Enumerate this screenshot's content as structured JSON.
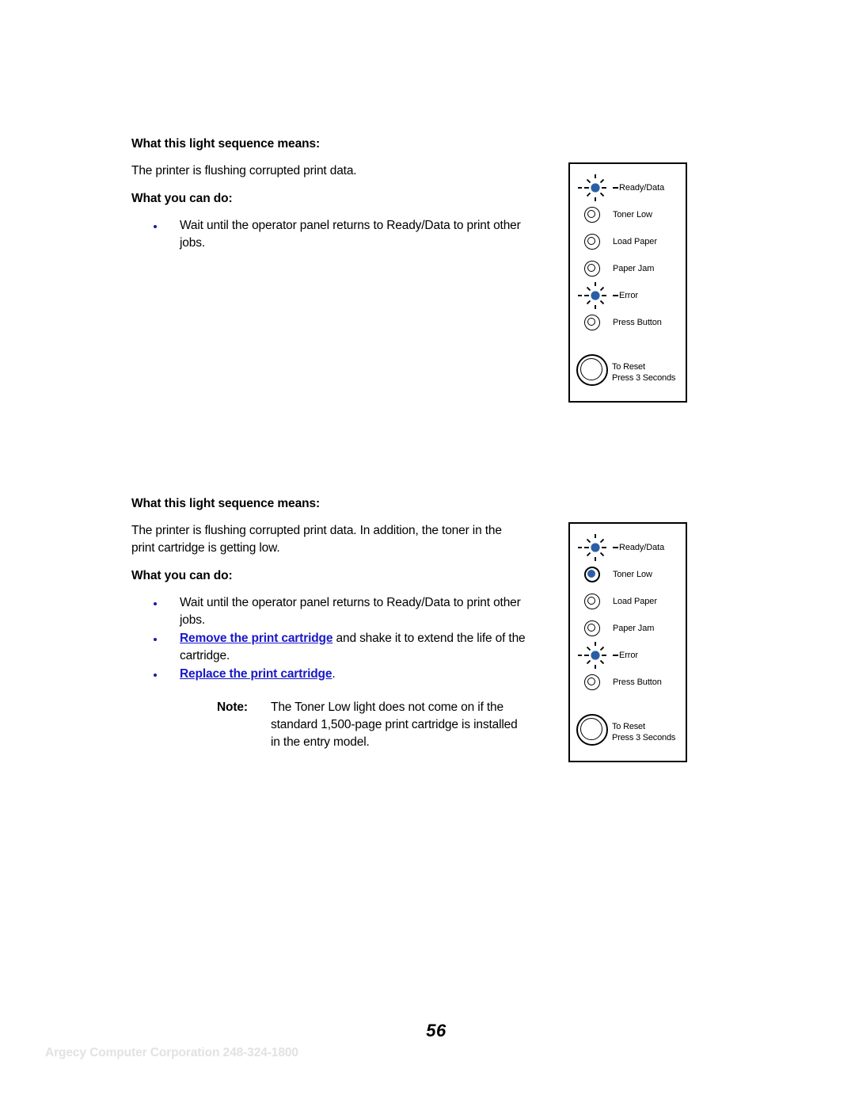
{
  "document": {
    "page_number": "56",
    "footer_credit": "Argecy Computer Corporation 248-324-1800"
  },
  "colors": {
    "link_blue": "#1818c8",
    "led_blue": "#2a5fa8",
    "bullet_blue": "#1a1aa8",
    "footer_gray": "#e2e2e2"
  },
  "sections": [
    {
      "means_heading": "What this light sequence means:",
      "means_body": "The printer is flushing corrupted print data.",
      "can_do_heading": "What you can do:",
      "bullets": [
        {
          "text": "Wait until the operator panel returns to Ready/Data to print other jobs."
        }
      ],
      "panel": {
        "lights": [
          {
            "label": "Ready/Data",
            "state": "blinking"
          },
          {
            "label": "Toner Low",
            "state": "off"
          },
          {
            "label": "Load Paper",
            "state": "off"
          },
          {
            "label": "Paper Jam",
            "state": "off"
          },
          {
            "label": "Error",
            "state": "blinking"
          },
          {
            "label": "Press Button",
            "state": "off"
          }
        ],
        "reset_line_1": "To Reset",
        "reset_line_2": "Press 3 Seconds"
      }
    },
    {
      "means_heading": "What this light sequence means:",
      "means_body": "The printer is flushing corrupted print data. In addition, the toner in the print cartridge is getting low.",
      "can_do_heading": "What you can do:",
      "bullets": [
        {
          "text": "Wait until the operator panel returns to Ready/Data to print other jobs."
        },
        {
          "link": "Remove the print cartridge",
          "text": " and shake it to extend the life of the cartridge."
        },
        {
          "link": "Replace the print cartridge",
          "text": "."
        }
      ],
      "note": {
        "label": "Note:",
        "text": "The Toner Low light does not come on if the standard 1,500-page print cartridge is installed in the entry model."
      },
      "panel": {
        "lights": [
          {
            "label": "Ready/Data",
            "state": "blinking"
          },
          {
            "label": "Toner Low",
            "state": "on"
          },
          {
            "label": "Load Paper",
            "state": "off"
          },
          {
            "label": "Paper Jam",
            "state": "off"
          },
          {
            "label": "Error",
            "state": "blinking"
          },
          {
            "label": "Press Button",
            "state": "off"
          }
        ],
        "reset_line_1": "To Reset",
        "reset_line_2": "Press 3 Seconds"
      }
    }
  ]
}
